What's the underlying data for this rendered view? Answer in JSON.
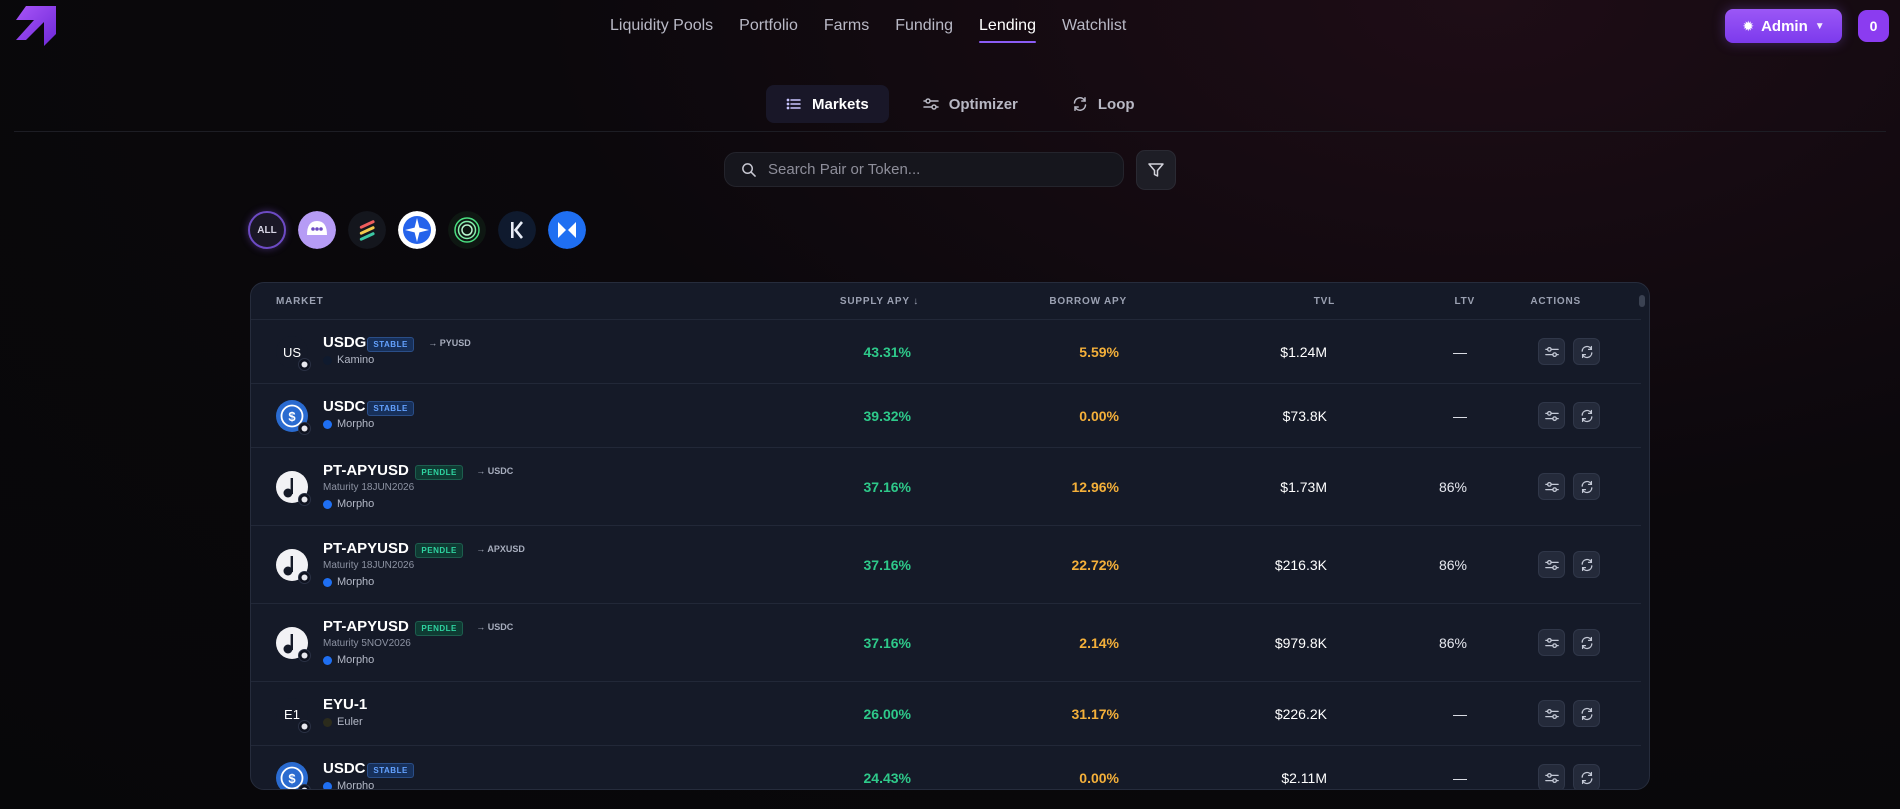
{
  "nav": {
    "links": [
      "Liquidity Pools",
      "Portfolio",
      "Farms",
      "Funding",
      "Lending",
      "Watchlist"
    ],
    "active": "Lending",
    "admin_label": "Admin",
    "avatar_label": "0"
  },
  "subtabs": {
    "markets": "Markets",
    "optimizer": "Optimizer",
    "loop": "Loop",
    "active": "Markets"
  },
  "search": {
    "placeholder": "Search Pair or Token..."
  },
  "chips": {
    "all_label": "ALL"
  },
  "table": {
    "headers": {
      "market": "MARKET",
      "supply": "SUPPLY APY ↓",
      "borrow": "BORROW APY",
      "tvl": "TVL",
      "ltv": "LTV",
      "actions": "ACTIONS"
    },
    "rows": [
      {
        "icon_text": "US",
        "name": "USDG",
        "badge": "STABLE",
        "badge_type": "stable",
        "to": "→ PYUSD",
        "maturity": "",
        "protocol": "Kamino",
        "supply": "43.31%",
        "borrow": "5.59%",
        "tvl": "$1.24M",
        "ltv": "—"
      },
      {
        "icon_text": "",
        "name": "USDC",
        "badge": "STABLE",
        "badge_type": "stable",
        "to": "",
        "maturity": "",
        "protocol": "Morpho",
        "supply": "39.32%",
        "borrow": "0.00%",
        "tvl": "$73.8K",
        "ltv": "—"
      },
      {
        "icon_text": "",
        "name": "PT-APYUSD",
        "badge": "PENDLE",
        "badge_type": "pendle",
        "to": "→ USDC",
        "maturity": "Maturity 18JUN2026",
        "protocol": "Morpho",
        "supply": "37.16%",
        "borrow": "12.96%",
        "tvl": "$1.73M",
        "ltv": "86%"
      },
      {
        "icon_text": "",
        "name": "PT-APYUSD",
        "badge": "PENDLE",
        "badge_type": "pendle",
        "to": "→ APXUSD",
        "maturity": "Maturity 18JUN2026",
        "protocol": "Morpho",
        "supply": "37.16%",
        "borrow": "22.72%",
        "tvl": "$216.3K",
        "ltv": "86%"
      },
      {
        "icon_text": "",
        "name": "PT-APYUSD",
        "badge": "PENDLE",
        "badge_type": "pendle",
        "to": "→ USDC",
        "maturity": "Maturity 5NOV2026",
        "protocol": "Morpho",
        "supply": "37.16%",
        "borrow": "2.14%",
        "tvl": "$979.8K",
        "ltv": "86%"
      },
      {
        "icon_text": "E1",
        "name": "EYU-1",
        "badge": "",
        "badge_type": "",
        "to": "",
        "maturity": "",
        "protocol": "Euler",
        "supply": "26.00%",
        "borrow": "31.17%",
        "tvl": "$226.2K",
        "ltv": "—"
      },
      {
        "icon_text": "",
        "name": "USDC",
        "badge": "STABLE",
        "badge_type": "stable",
        "to": "",
        "maturity": "",
        "protocol": "Morpho",
        "supply": "24.43%",
        "borrow": "0.00%",
        "tvl": "$2.11M",
        "ltv": "—"
      }
    ]
  },
  "colors": {
    "accent": "#8b5cf6",
    "supply_green": "#2ec98a",
    "borrow_orange": "#f4b03a",
    "stable_blue": "#64a2ff",
    "pendle_teal": "#2fd3a0"
  }
}
